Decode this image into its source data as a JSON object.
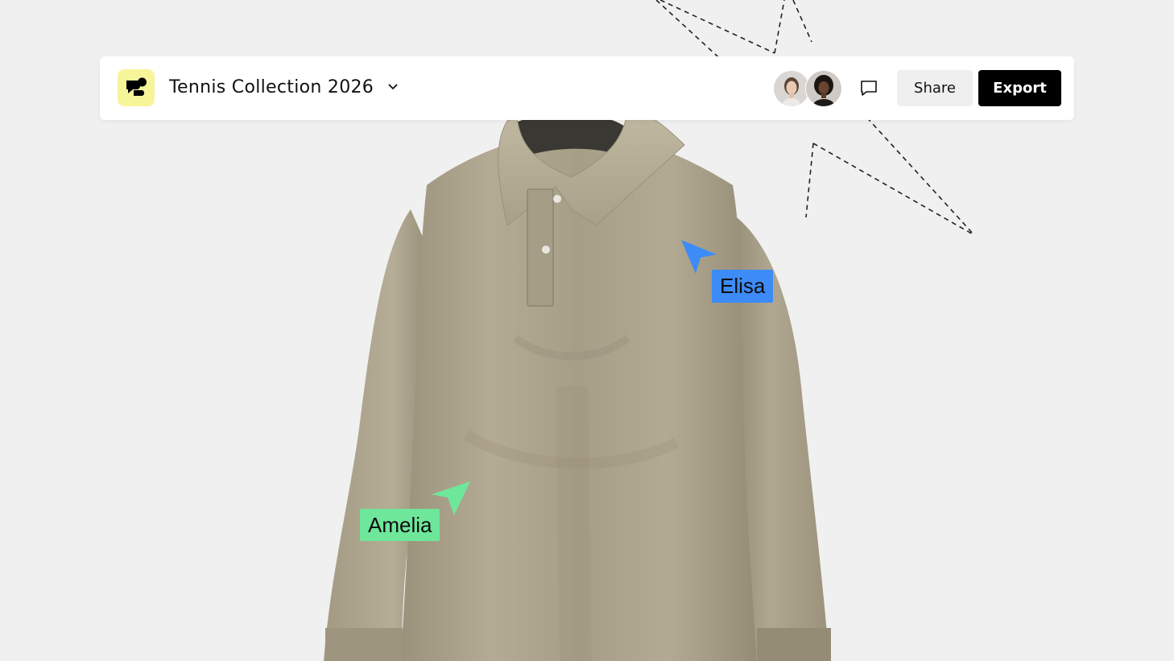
{
  "toolbar": {
    "logo_icon": "chat-bubbles-logo-icon",
    "logo_color": "#f6f59a",
    "project_title": "Tennis Collection 2026",
    "title_dropdown_icon": "chevron-down-icon",
    "collaborators": [
      {
        "avatar": "avatar-woman-light-hair"
      },
      {
        "avatar": "avatar-woman-dark-hair"
      }
    ],
    "comment_icon": "comment-icon",
    "share_label": "Share",
    "export_label": "Export"
  },
  "canvas": {
    "background": "#f0f0f0",
    "garment": "beige long-sleeve polo",
    "garment_color": "#b1a891"
  },
  "cursors": [
    {
      "name": "Elisa",
      "color": "#3d8bf7",
      "icon": "pointer-arrow-icon"
    },
    {
      "name": "Amelia",
      "color": "#6ee79a",
      "icon": "pointer-arrow-icon"
    }
  ]
}
